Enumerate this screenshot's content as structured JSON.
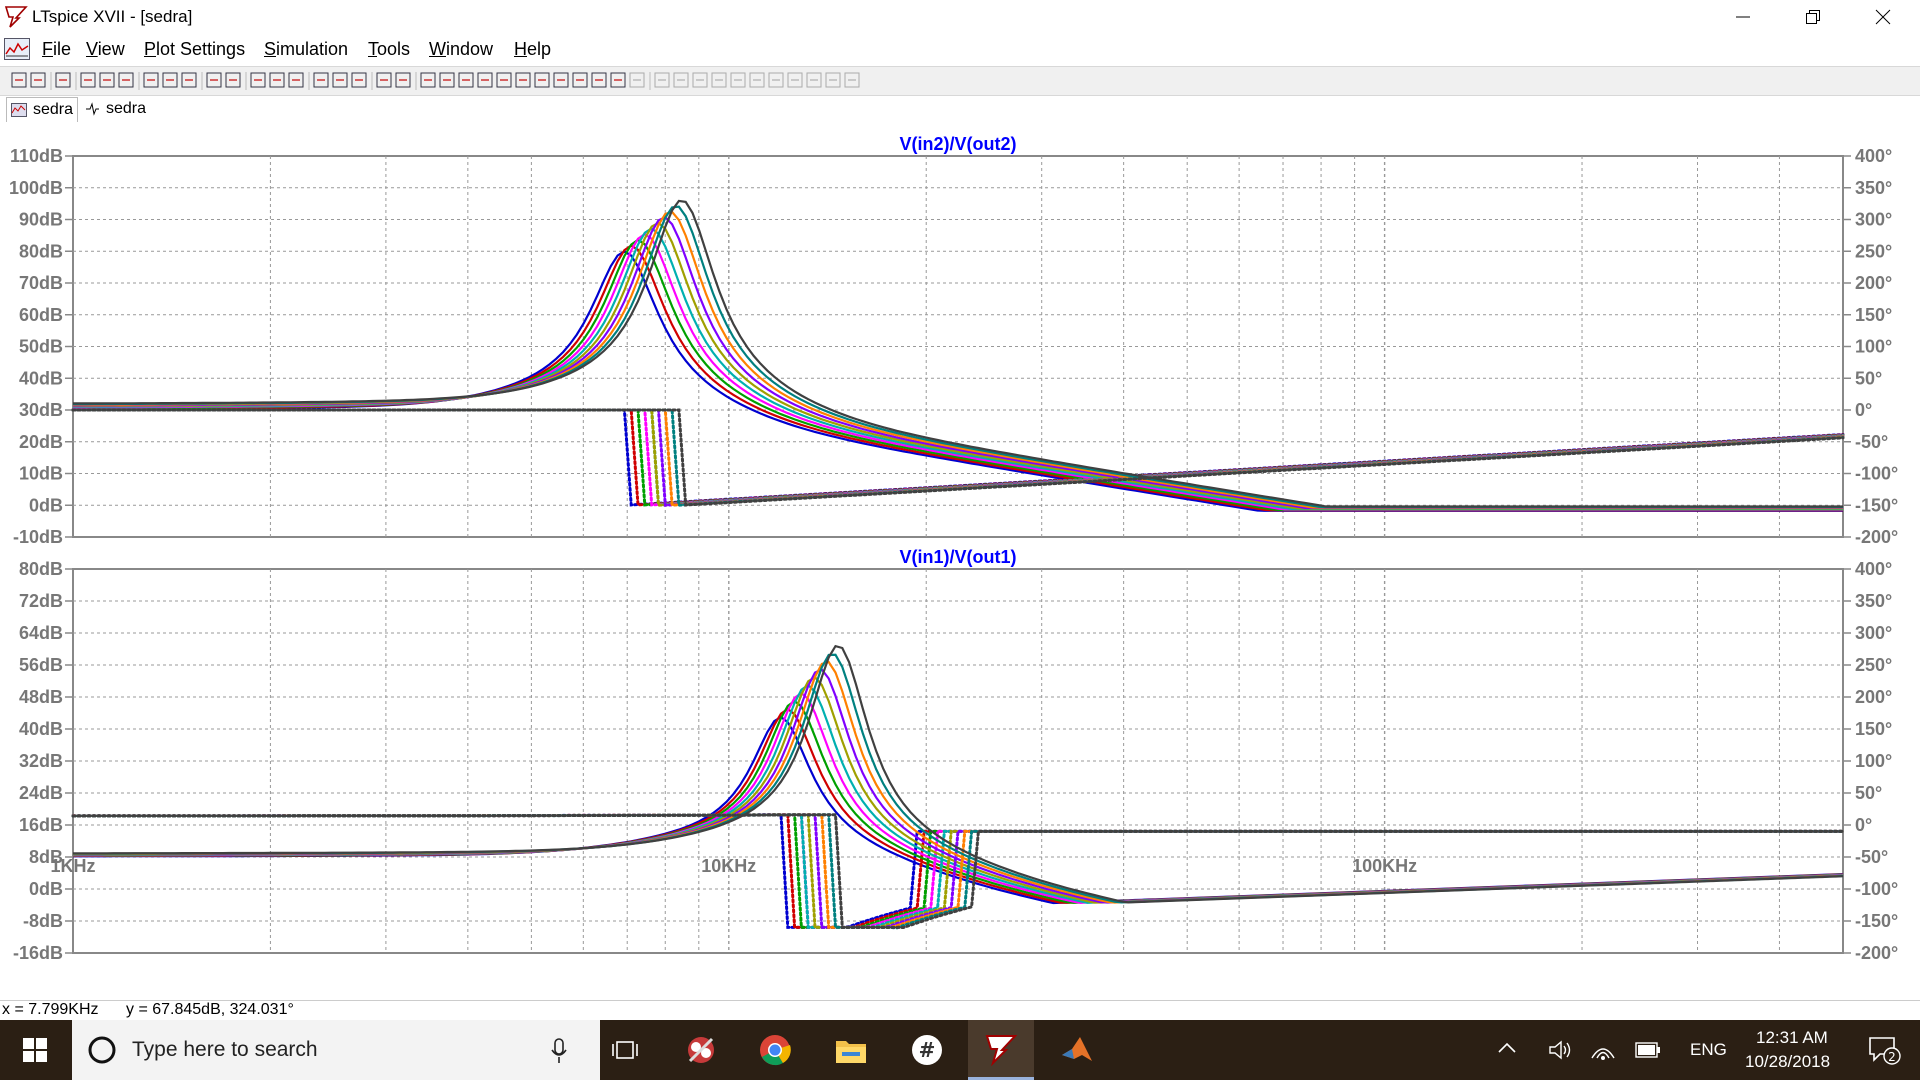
{
  "window": {
    "title": "LTspice XVII - [sedra]",
    "buttons": [
      "minimize",
      "restore",
      "close"
    ]
  },
  "menu": {
    "items": [
      {
        "label": "File",
        "key": "F"
      },
      {
        "label": "View",
        "key": "V"
      },
      {
        "label": "Plot Settings",
        "key": "P"
      },
      {
        "label": "Simulation",
        "key": "S"
      },
      {
        "label": "Tools",
        "key": "T"
      },
      {
        "label": "Window",
        "key": "W"
      },
      {
        "label": "Help",
        "key": "H"
      }
    ],
    "mdi": [
      "–",
      "▫",
      "×"
    ]
  },
  "tabs": [
    {
      "label": "sedra",
      "icon": "waveform-icon"
    },
    {
      "label": "sedra",
      "icon": "schematic-icon"
    }
  ],
  "plots": [
    {
      "title": "V(in2)/V(out2)",
      "left_ticks": [
        "110dB",
        "100dB",
        "90dB",
        "80dB",
        "70dB",
        "60dB",
        "50dB",
        "40dB",
        "30dB",
        "20dB",
        "10dB",
        "0dB",
        "-10dB"
      ],
      "right_ticks": [
        "400°",
        "350°",
        "300°",
        "250°",
        "200°",
        "150°",
        "100°",
        "50°",
        "0°",
        "-50°",
        "-100°",
        "-150°",
        "-200°"
      ],
      "ylim_db": [
        -10,
        110
      ],
      "ylim_deg": [
        -200,
        400
      ],
      "peak_khz": 7.8,
      "peak_db": 93
    },
    {
      "title": "V(in1)/V(out1)",
      "left_ticks": [
        "80dB",
        "72dB",
        "64dB",
        "56dB",
        "48dB",
        "40dB",
        "32dB",
        "24dB",
        "16dB",
        "8dB",
        "0dB",
        "-8dB",
        "-16dB"
      ],
      "right_ticks": [
        "400°",
        "350°",
        "300°",
        "250°",
        "200°",
        "150°",
        "100°",
        "50°",
        "0°",
        "-50°",
        "-100°",
        "-150°",
        "-200°"
      ],
      "ylim_db": [
        -16,
        80
      ],
      "ylim_deg": [
        -200,
        400
      ],
      "peak_khz": 13.5,
      "peak_db": 63
    }
  ],
  "x_axis": {
    "labels": [
      "1KHz",
      "10KHz",
      "100KHz"
    ],
    "xlim_hz": [
      1000,
      500000
    ],
    "log": true
  },
  "chart_data": [
    {
      "type": "line",
      "title": "V(in2)/V(out2)",
      "x_scale": "log",
      "xlim": [
        1000,
        500000
      ],
      "ylim": [
        -10,
        110
      ],
      "y2lim": [
        -200,
        400
      ],
      "series_colors": [
        "#0000d0",
        "#d00000",
        "#00a000",
        "#ff00ff",
        "#00b0b0",
        "#a0a000",
        "#8000ff",
        "#ff8000",
        "#008080",
        "#404040"
      ]
    },
    {
      "type": "line",
      "title": "V(in1)/V(out1)",
      "x_scale": "log",
      "xlim": [
        1000,
        500000
      ],
      "ylim": [
        -16,
        80
      ],
      "y2lim": [
        -200,
        400
      ],
      "series_colors": [
        "#0000d0",
        "#d00000",
        "#00a000",
        "#ff00ff",
        "#00b0b0",
        "#a0a000",
        "#8000ff",
        "#ff8000",
        "#008080",
        "#404040"
      ]
    }
  ],
  "status": {
    "x": "x = 7.799KHz",
    "y": "y = 67.845dB, 324.031°"
  },
  "taskbar": {
    "search_placeholder": "Type here to search",
    "time": "12:31 AM",
    "date": "10/28/2018",
    "lang": "ENG",
    "notifications": "2",
    "apps": [
      "task-view",
      "snipping-tool",
      "chrome",
      "file-explorer",
      "slack",
      "ltspice",
      "matlab"
    ]
  },
  "colors": {
    "title_blue": "#0000ff",
    "grid": "#999999",
    "axis_text": "#777777"
  }
}
